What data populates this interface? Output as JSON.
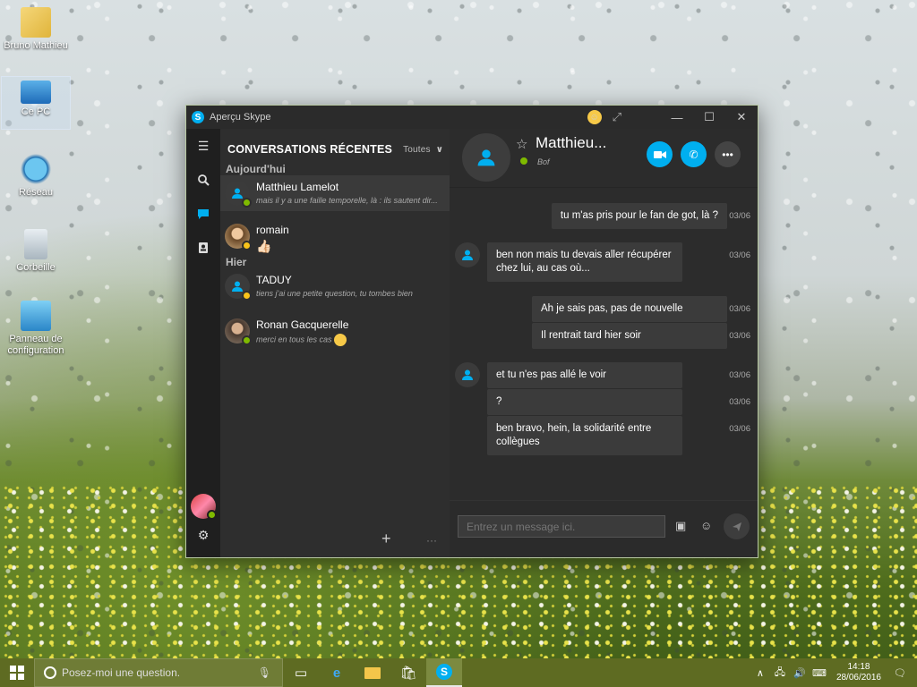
{
  "desktop": {
    "icons": [
      {
        "label": "Bruno Mathieu"
      },
      {
        "label": "Ce PC"
      },
      {
        "label": "Réseau"
      },
      {
        "label": "Corbeille"
      },
      {
        "label": "Panneau de configuration"
      }
    ]
  },
  "window": {
    "title": "Aperçu Skype",
    "minimize": "—",
    "maximize": "☐",
    "close": "✕"
  },
  "conversations": {
    "header": "CONVERSATIONS RÉCENTES",
    "filter": "Toutes",
    "sections": {
      "today": "Aujourd'hui",
      "yesterday": "Hier"
    },
    "items": [
      {
        "name": "Matthieu Lamelot",
        "preview": "mais il y a une faille temporelle, là : ils sautent dir...",
        "status": "online"
      },
      {
        "name": "romain",
        "preview": "👍🏻",
        "status": "away"
      },
      {
        "name": "TADUY",
        "preview": "tiens j'ai une petite question, tu tombes bien",
        "status": "away"
      },
      {
        "name": "Ronan Gacquerelle",
        "preview": "merci en tous les cas",
        "status": "online"
      }
    ]
  },
  "chat": {
    "contact_name": "Matthieu...",
    "mood": "Bof",
    "messages": [
      {
        "side": "out",
        "text": "tu m'as pris pour le fan de got, là ?",
        "time": "03/06"
      },
      {
        "side": "in",
        "text": "ben non mais tu devais aller récupérer chez lui, au cas où...",
        "time": "03/06"
      },
      {
        "side": "out",
        "text": "Ah je sais pas, pas de nouvelle",
        "time": "03/06"
      },
      {
        "side": "out",
        "text": "Il rentrait tard hier soir",
        "time": "03/06"
      },
      {
        "side": "in",
        "text": "et tu n'es pas allé le voir",
        "time": "03/06"
      },
      {
        "side": "in",
        "text": "?",
        "time": "03/06"
      },
      {
        "side": "in",
        "text": "ben bravo, hein, la solidarité entre collègues",
        "time": "03/06"
      }
    ],
    "composer_placeholder": "Entrez un message ici."
  },
  "taskbar": {
    "search_placeholder": "Posez-moi une question.",
    "time": "14:18",
    "date": "28/06/2016"
  },
  "colors": {
    "accent": "#00aff0",
    "online": "#7fba00",
    "away": "#f8c21a"
  }
}
